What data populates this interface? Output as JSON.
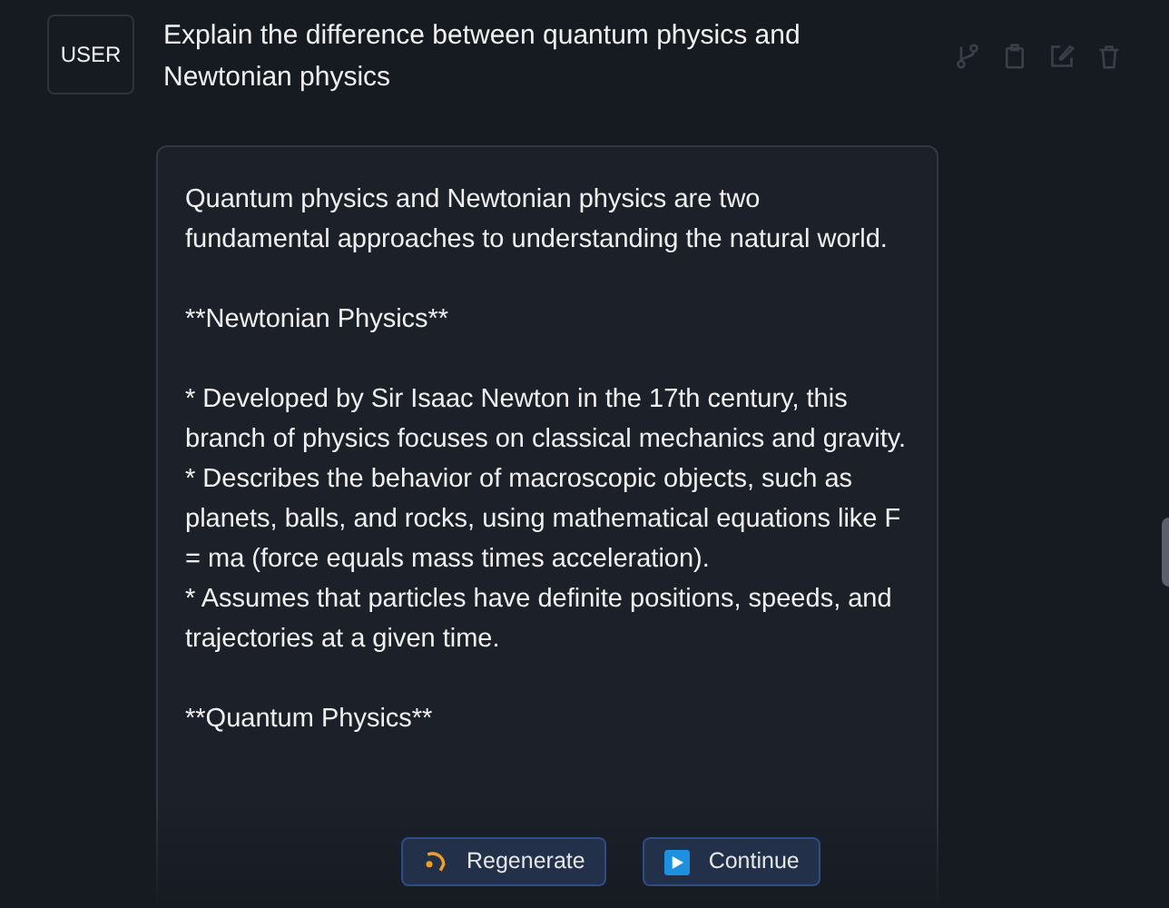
{
  "message": {
    "role": "USER",
    "text": "Explain the difference between quantum physics and Newtonian physics"
  },
  "response": {
    "blocks": [
      [
        "Quantum physics and Newtonian physics are two fundamental approaches to understanding the natural world."
      ],
      [
        "**Newtonian Physics**"
      ],
      [
        "* Developed by Sir Isaac Newton in the 17th century, this branch of physics focuses on classical mechanics and gravity.",
        "* Describes the behavior of macroscopic objects, such as planets, balls, and rocks, using mathematical equations like F = ma (force equals mass times acceleration).",
        "* Assumes that particles have definite positions, speeds, and trajectories at a given time."
      ],
      [
        "**Quantum Physics**"
      ]
    ]
  },
  "actions": [
    {
      "kind": "regenerate",
      "label": "Regenerate"
    },
    {
      "kind": "continue",
      "label": "Continue"
    }
  ]
}
